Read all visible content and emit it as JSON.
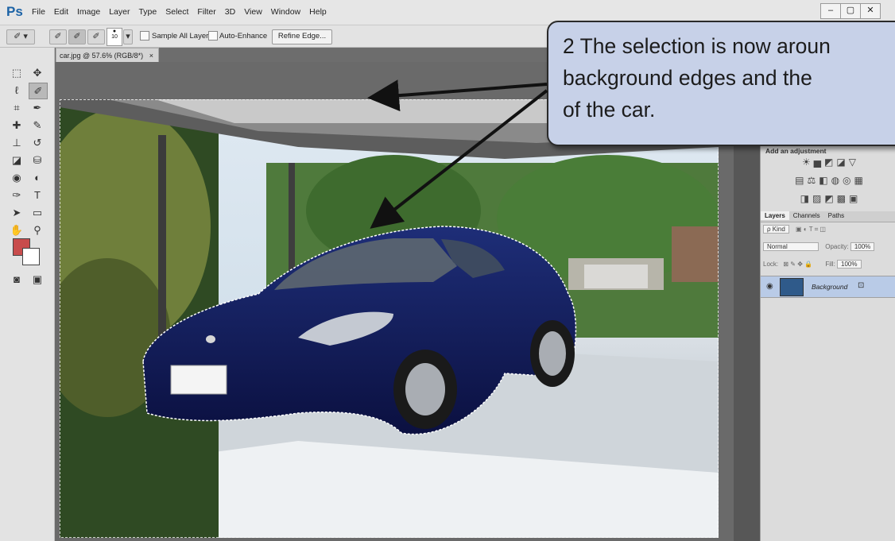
{
  "app": {
    "logo": "Ps"
  },
  "menu": [
    "File",
    "Edit",
    "Image",
    "Layer",
    "Type",
    "Select",
    "Filter",
    "3D",
    "View",
    "Window",
    "Help"
  ],
  "window_controls": [
    "–",
    "▢",
    "✕"
  ],
  "options_bar": {
    "brush_size": "10",
    "sample_all_layers": "Sample All Layers",
    "auto_enhance": "Auto-Enhance",
    "refine_edge": "Refine Edge..."
  },
  "document": {
    "tab_title": "car.jpg @ 57.6% (RGB/8*)",
    "tab_close": "×"
  },
  "adjustments": {
    "label": "Add an adjustment"
  },
  "layers_panel": {
    "tabs": [
      "Layers",
      "Channels",
      "Paths"
    ],
    "kind": "ρ Kind",
    "blend_mode": "Normal",
    "opacity_label": "Opacity:",
    "opacity_value": "100%",
    "lock_label": "Lock:",
    "fill_label": "Fill:",
    "fill_value": "100%",
    "layer_name": "Background"
  },
  "callout": {
    "text": "2  The selection is now aroun\nbackground edges and the\nof the car."
  },
  "colors": {
    "foreground": "#c84c4c",
    "background": "#ffffff",
    "callout_fill": "#c7d1e8"
  }
}
